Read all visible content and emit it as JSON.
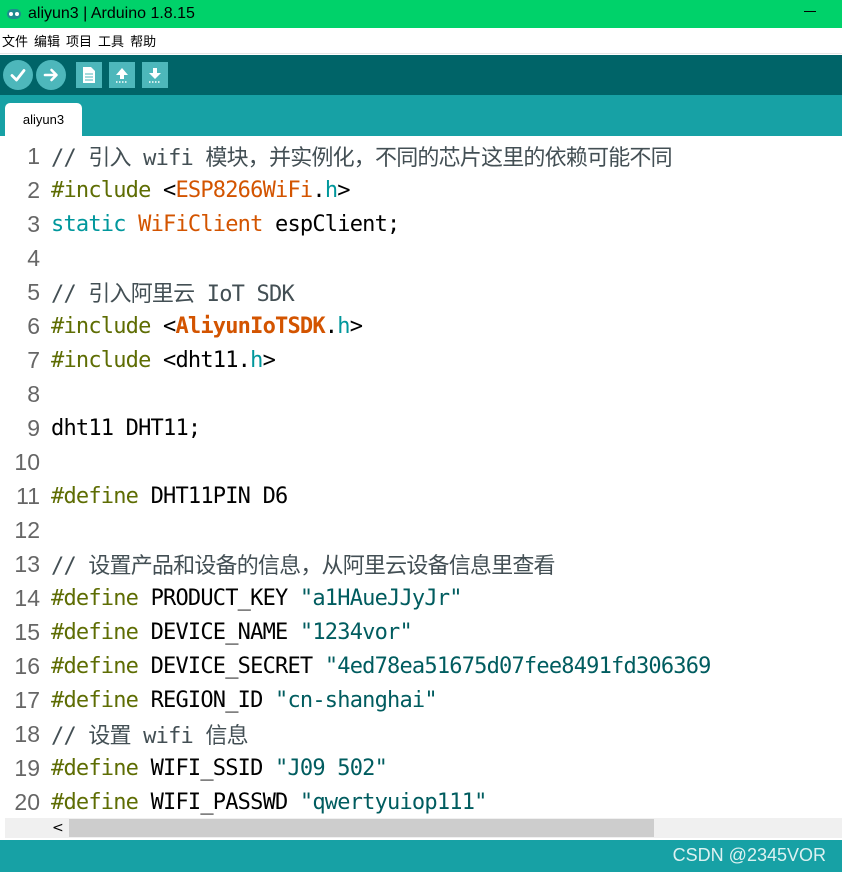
{
  "window": {
    "title": "aliyun3 | Arduino 1.8.15"
  },
  "menu": [
    "文件",
    "编辑",
    "项目",
    "工具",
    "帮助"
  ],
  "toolbar": {
    "buttons": [
      "verify-icon",
      "upload-icon",
      "new-icon",
      "open-icon",
      "save-icon"
    ]
  },
  "tab": {
    "label": "aliyun3"
  },
  "code": [
    {
      "n": "1",
      "tokens": [
        {
          "t": "// 引入 wifi 模块，并实例化，不同的芯片这里的依赖可能不同",
          "c": "c-comment"
        }
      ]
    },
    {
      "n": "2",
      "tokens": [
        {
          "t": "#include",
          "c": "c-kw"
        },
        {
          "t": " <",
          "c": "c-punct"
        },
        {
          "t": "ESP8266WiFi",
          "c": "c-lib"
        },
        {
          "t": ".",
          "c": "c-punct"
        },
        {
          "t": "h",
          "c": "c-ext"
        },
        {
          "t": ">",
          "c": "c-punct"
        }
      ]
    },
    {
      "n": "3",
      "tokens": [
        {
          "t": "static",
          "c": "c-type"
        },
        {
          "t": " ",
          "c": "c-punct"
        },
        {
          "t": "WiFiClient",
          "c": "c-lib"
        },
        {
          "t": " espClient;",
          "c": "c-punct"
        }
      ]
    },
    {
      "n": "4",
      "tokens": []
    },
    {
      "n": "5",
      "tokens": [
        {
          "t": "// 引入阿里云 IoT SDK",
          "c": "c-comment"
        }
      ]
    },
    {
      "n": "6",
      "tokens": [
        {
          "t": "#include",
          "c": "c-kw"
        },
        {
          "t": " <",
          "c": "c-punct"
        },
        {
          "t": "AliyunIoTSDK",
          "c": "c-lib bold"
        },
        {
          "t": ".",
          "c": "c-punct"
        },
        {
          "t": "h",
          "c": "c-ext"
        },
        {
          "t": ">",
          "c": "c-punct"
        }
      ]
    },
    {
      "n": "7",
      "tokens": [
        {
          "t": "#include",
          "c": "c-kw"
        },
        {
          "t": " <dht11.",
          "c": "c-punct"
        },
        {
          "t": "h",
          "c": "c-ext"
        },
        {
          "t": ">",
          "c": "c-punct"
        }
      ]
    },
    {
      "n": "8",
      "tokens": []
    },
    {
      "n": "9",
      "tokens": [
        {
          "t": "dht11 DHT11;",
          "c": "c-punct"
        }
      ]
    },
    {
      "n": "10",
      "tokens": []
    },
    {
      "n": "11",
      "tokens": [
        {
          "t": "#define",
          "c": "c-kw"
        },
        {
          "t": " DHT11PIN D6",
          "c": "c-punct"
        }
      ]
    },
    {
      "n": "12",
      "tokens": []
    },
    {
      "n": "13",
      "tokens": [
        {
          "t": "// 设置产品和设备的信息，从阿里云设备信息里查看",
          "c": "c-comment"
        }
      ]
    },
    {
      "n": "14",
      "tokens": [
        {
          "t": "#define",
          "c": "c-kw"
        },
        {
          "t": " PRODUCT_KEY ",
          "c": "c-punct"
        },
        {
          "t": "\"a1HAueJJyJr\"",
          "c": "c-str"
        }
      ]
    },
    {
      "n": "15",
      "tokens": [
        {
          "t": "#define",
          "c": "c-kw"
        },
        {
          "t": " DEVICE_NAME ",
          "c": "c-punct"
        },
        {
          "t": "\"1234vor\"",
          "c": "c-str"
        }
      ]
    },
    {
      "n": "16",
      "tokens": [
        {
          "t": "#define",
          "c": "c-kw"
        },
        {
          "t": " DEVICE_SECRET ",
          "c": "c-punct"
        },
        {
          "t": "\"4ed78ea51675d07fee8491fd306369",
          "c": "c-str"
        }
      ]
    },
    {
      "n": "17",
      "tokens": [
        {
          "t": "#define",
          "c": "c-kw"
        },
        {
          "t": " REGION_ID ",
          "c": "c-punct"
        },
        {
          "t": "\"cn-shanghai\"",
          "c": "c-str"
        }
      ]
    },
    {
      "n": "18",
      "tokens": [
        {
          "t": "// 设置 wifi 信息",
          "c": "c-comment"
        }
      ]
    },
    {
      "n": "19",
      "tokens": [
        {
          "t": "#define",
          "c": "c-kw"
        },
        {
          "t": " WIFI_SSID ",
          "c": "c-punct"
        },
        {
          "t": "\"J09 502\"",
          "c": "c-str"
        }
      ]
    },
    {
      "n": "20",
      "tokens": [
        {
          "t": "#define",
          "c": "c-kw"
        },
        {
          "t": " WIFI_PASSWD ",
          "c": "c-punct"
        },
        {
          "t": "\"qwertyuiop111\"",
          "c": "c-str"
        }
      ]
    }
  ],
  "scrollbar": {
    "left_arrow": "<"
  },
  "watermark": "CSDN @2345VOR",
  "colors": {
    "titlebar": "#00d26a",
    "toolbar": "#006468",
    "tabbar": "#17a1a5",
    "button": "#4db7bb"
  }
}
